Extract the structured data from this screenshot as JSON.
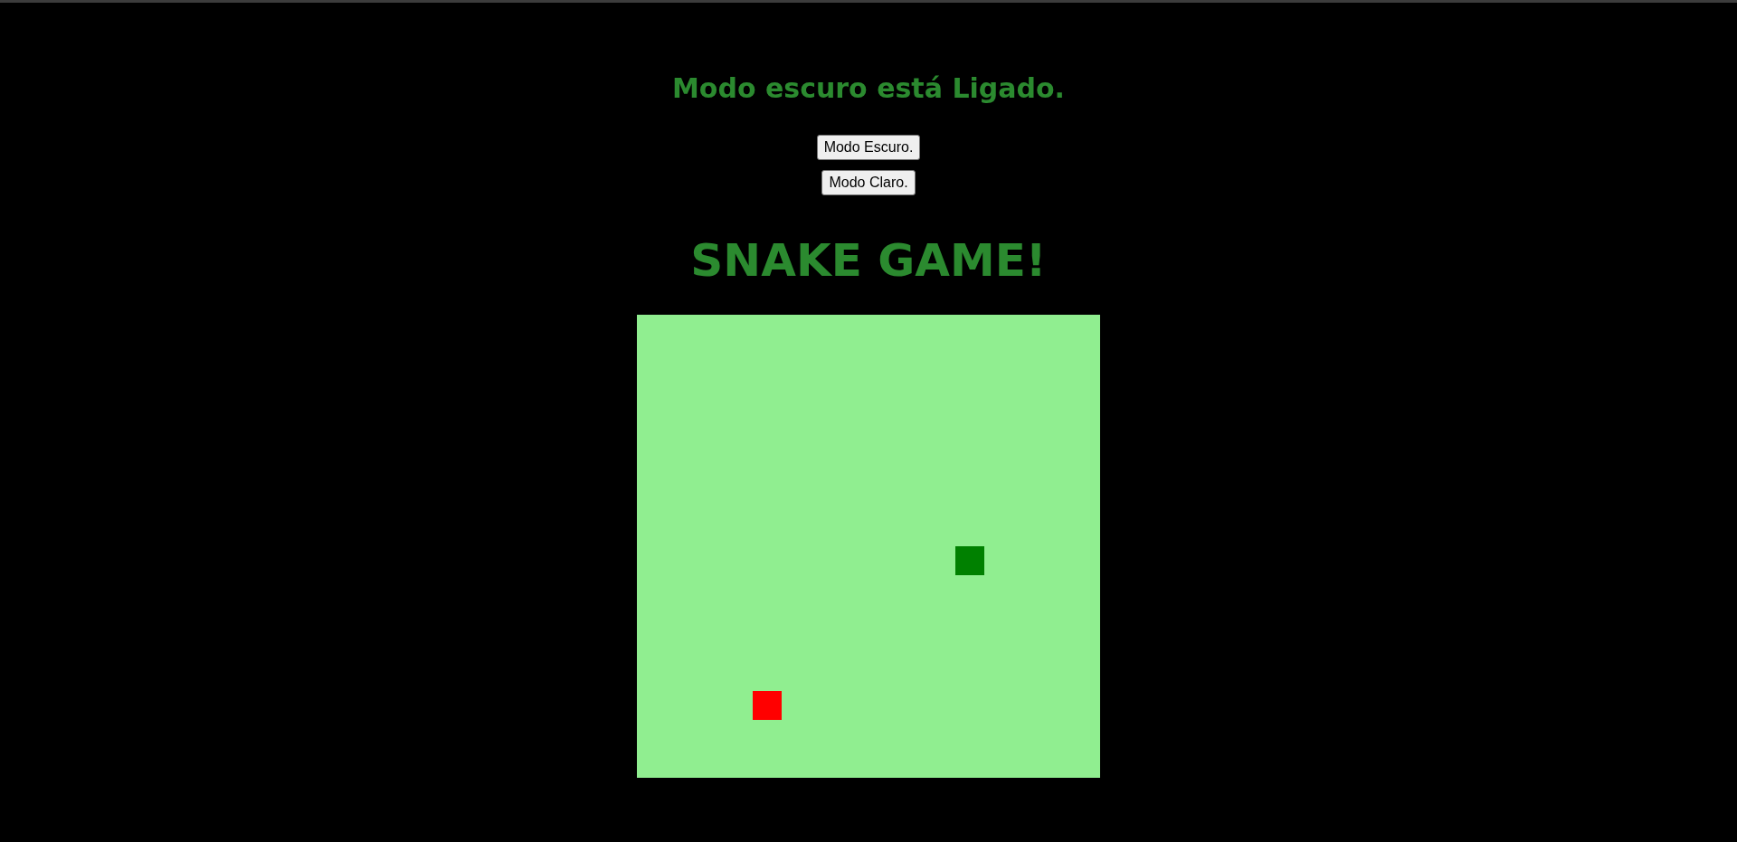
{
  "dark_mode": true,
  "status": {
    "text": "Modo escuro está Ligado."
  },
  "buttons": [
    {
      "label": "Modo Escuro."
    },
    {
      "label": "Modo Claro."
    }
  ],
  "title": "SNAKE GAME!"
}
